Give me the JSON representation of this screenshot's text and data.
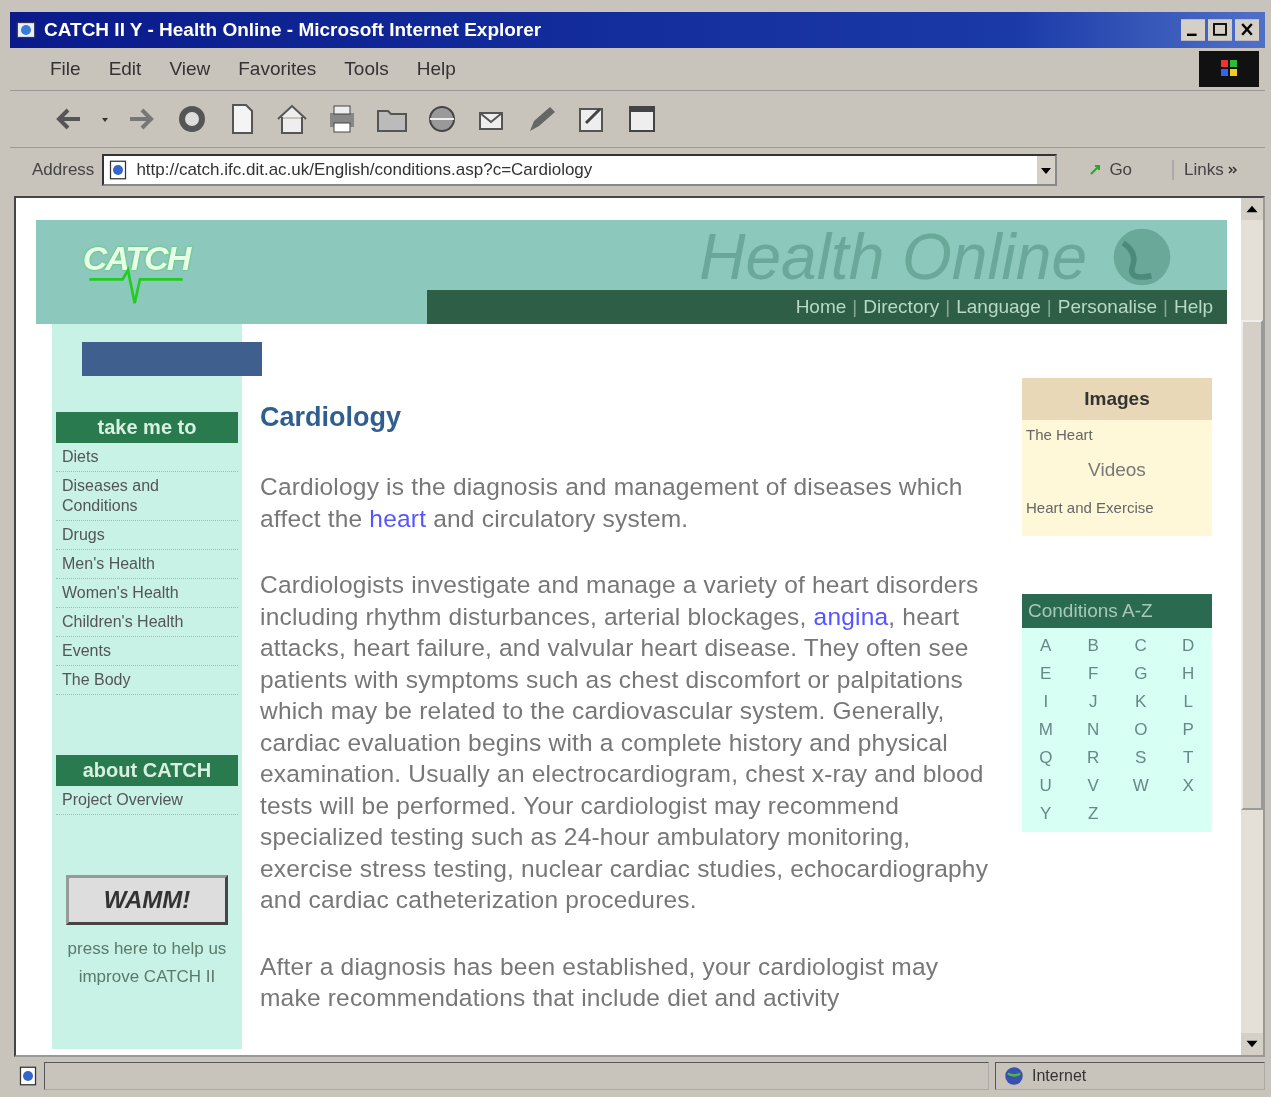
{
  "window": {
    "title": "CATCH II Y - Health Online - Microsoft Internet Explorer"
  },
  "menu": [
    "File",
    "Edit",
    "View",
    "Favorites",
    "Tools",
    "Help"
  ],
  "address_bar": {
    "label": "Address",
    "value": "http://catch.ifc.dit.ac.uk/English/conditions.asp?c=Cardiology",
    "go": "Go",
    "links": "Links"
  },
  "banner": {
    "logo": "CATCH",
    "title": "Health Online",
    "nav": [
      {
        "kind": "link",
        "text": "Home"
      },
      {
        "kind": "separator",
        "text": "|"
      },
      {
        "kind": "link",
        "text": "Directory"
      },
      {
        "kind": "separator",
        "text": "|"
      },
      {
        "kind": "link",
        "text": "Language"
      },
      {
        "kind": "separator",
        "text": "|"
      },
      {
        "kind": "link",
        "text": "Personalise"
      },
      {
        "kind": "separator",
        "text": "|"
      },
      {
        "kind": "link",
        "text": "Help"
      }
    ]
  },
  "sidebar": {
    "sections": [
      {
        "heading": "take me to",
        "items": [
          "Diets",
          "Diseases and Conditions",
          "Drugs",
          "Men's Health",
          "Women's Health",
          "Children's Health",
          "Events",
          "The Body"
        ]
      },
      {
        "heading": "about CATCH",
        "items": [
          "Project Overview"
        ]
      }
    ],
    "feedback": {
      "badge": "WAMM!",
      "caption": "press here to help us improve CATCH II"
    }
  },
  "article": {
    "title": "Cardiology",
    "paragraphs": [
      [
        {
          "kind": "text",
          "text": "Cardiology is the diagnosis and management of diseases which affect the "
        },
        {
          "kind": "link",
          "text": "heart"
        },
        {
          "kind": "text",
          "text": " and circulatory system."
        }
      ],
      [
        {
          "kind": "text",
          "text": "Cardiologists investigate and manage a variety of heart disorders including rhythm disturbances, arterial blockages, "
        },
        {
          "kind": "link",
          "text": "angina"
        },
        {
          "kind": "text",
          "text": ", heart attacks, heart failure, and valvular heart disease. They often see patients with symptoms such as chest discomfort or palpitations which may be related to the cardiovascular system. Generally, cardiac evaluation begins with a complete history and physical examination. Usually an electrocardiogram, chest x-ray and blood tests will be performed. Your cardiologist may recommend specialized testing such as 24-hour ambulatory monitoring, exercise stress testing, nuclear cardiac studies, echocardiography and cardiac catheterization procedures."
        }
      ],
      [
        {
          "kind": "text",
          "text": "After a diagnosis has been established, your cardiologist may make recommendations that include diet and activity"
        }
      ]
    ]
  },
  "images_box": {
    "heading": "Images",
    "items": [
      {
        "kind": "link",
        "text": "The Heart"
      },
      {
        "kind": "subheading",
        "text": "Videos"
      },
      {
        "kind": "link",
        "text": "Heart and Exercise"
      }
    ]
  },
  "conditions_az": {
    "heading": "Conditions A-Z",
    "letters": [
      "A",
      "B",
      "C",
      "D",
      "E",
      "F",
      "G",
      "H",
      "I",
      "J",
      "K",
      "L",
      "M",
      "N",
      "O",
      "P",
      "Q",
      "R",
      "S",
      "T",
      "U",
      "V",
      "W",
      "X",
      "Y",
      "Z"
    ]
  },
  "status_bar": {
    "zone": "Internet"
  }
}
